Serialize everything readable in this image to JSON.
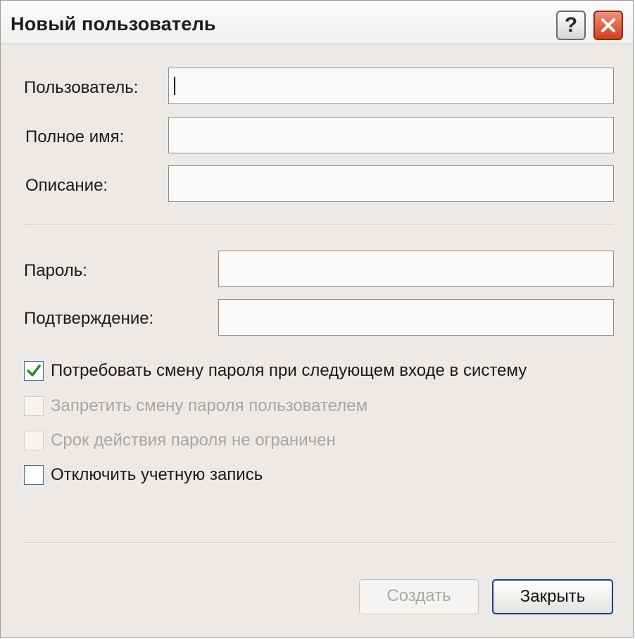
{
  "window": {
    "title": "Новый пользователь",
    "help_symbol": "?"
  },
  "fields": [
    {
      "label": "Пользователь:",
      "value": ""
    },
    {
      "label": "Полное имя:",
      "value": ""
    },
    {
      "label": "Описание:",
      "value": ""
    }
  ],
  "password_fields": [
    {
      "label": "Пароль:",
      "value": ""
    },
    {
      "label": "Подтверждение:",
      "value": ""
    }
  ],
  "checkboxes": [
    {
      "label": "Потребовать смену пароля при следующем входе в систему",
      "checked": true,
      "enabled": true
    },
    {
      "label": "Запретить смену пароля пользователем",
      "checked": false,
      "enabled": false
    },
    {
      "label": "Срок действия пароля не ограничен",
      "checked": false,
      "enabled": false
    },
    {
      "label": "Отключить учетную запись",
      "checked": false,
      "enabled": true
    }
  ],
  "buttons": {
    "create_label": "Создать",
    "create_enabled": false,
    "close_label": "Закрыть"
  },
  "colors": {
    "check_mark": "#2b8a2b",
    "close_button": "#d53f1e"
  },
  "icons": {
    "help": "question-mark-icon",
    "close": "close-x-icon",
    "check": "checkmark-icon"
  }
}
